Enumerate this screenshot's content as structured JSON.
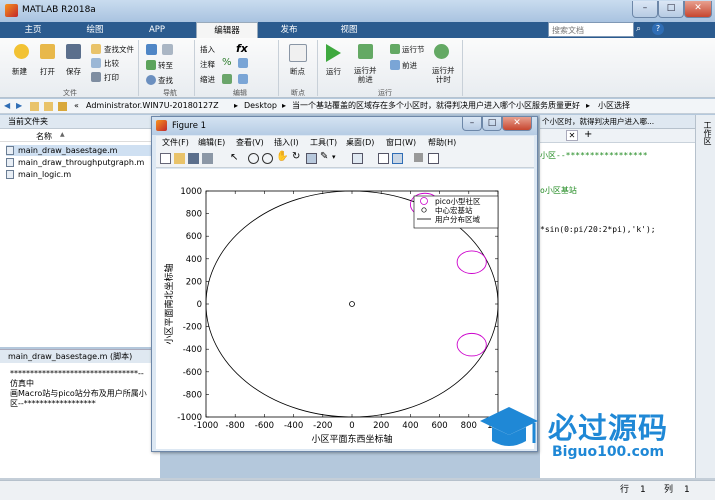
{
  "app": {
    "title": "MATLAB R2018a"
  },
  "window_controls": {
    "minimize": "–",
    "maximize": "□",
    "close": "✕"
  },
  "tabs": [
    {
      "label": "主页"
    },
    {
      "label": "绘图"
    },
    {
      "label": "APP"
    },
    {
      "label": "编辑器"
    },
    {
      "label": "发布"
    },
    {
      "label": "视图"
    }
  ],
  "search": {
    "placeholder": "搜索文档"
  },
  "ribbon": {
    "file": {
      "new": "新建",
      "open": "打开",
      "save": "保存",
      "find_files": "查找文件",
      "compare": "比较",
      "print": "打印",
      "group": "文件"
    },
    "navigate": {
      "goto": "转至",
      "find": "查找",
      "group": "导航"
    },
    "edit": {
      "insert": "插入",
      "comment": "注释",
      "indent": "缩进",
      "group": "编辑"
    },
    "breakpoints": {
      "label": "断点",
      "group": "断点"
    },
    "run": {
      "run": "运行",
      "run_advance": "运行并\n前进",
      "run_section": "运行节",
      "advance": "前进",
      "run_time": "运行并\n计时",
      "group": "运行"
    }
  },
  "pathbar": {
    "sep": "«",
    "crumbs": [
      "Administrator.WIN7U-20180127Z",
      "Desktop",
      "当一个基站覆盖的区域存在多个小区时，就得判决用户进入哪个小区服务质量更好",
      "小区选择"
    ]
  },
  "current_folder": {
    "title": "当前文件夹",
    "column": "名称",
    "sort": "▲",
    "files": [
      "main_draw_basestage.m",
      "main_draw_throughputgraph.m",
      "main_logic.m"
    ]
  },
  "details": {
    "title": "main_draw_basestage.m  (脚本)",
    "text": [
      "********************************--仿真中",
      "画Macro站与pico站分布及用户所属小",
      "区--******************"
    ]
  },
  "editor": {
    "tab_title": "个小区时，就得判决用户进入哪...",
    "lines": [
      "小区--*****************",
      "o小区基站",
      "*sin(0:pi/20:2*pi),'k');"
    ],
    "add_tab": "+"
  },
  "right_strip": {
    "label": "工作区"
  },
  "status": {
    "row_label": "行",
    "row": "1",
    "col_label": "列",
    "col": "1"
  },
  "figure": {
    "title": "Figure 1",
    "menu": [
      "文件(F)",
      "编辑(E)",
      "查看(V)",
      "插入(I)",
      "工具(T)",
      "桌面(D)",
      "窗口(W)",
      "帮助(H)"
    ]
  },
  "watermark": {
    "brand": "必过源码",
    "url": "Biguo100.com"
  },
  "chart_data": {
    "type": "scatter",
    "xlim": [
      -1000,
      1000
    ],
    "ylim": [
      -1000,
      1000
    ],
    "xticks": [
      -1000,
      -800,
      -600,
      -400,
      -200,
      0,
      200,
      400,
      600,
      800,
      1000
    ],
    "yticks": [
      -1000,
      -800,
      -600,
      -400,
      -200,
      0,
      200,
      400,
      600,
      800,
      1000
    ],
    "xlabel": "小区平面东西坐标轴",
    "ylabel": "小区平面南北坐标轴",
    "grid": false,
    "legend_position": "top-right",
    "legend": [
      "pico小型社区",
      "中心宏基站",
      "用户分布区域"
    ],
    "series": [
      {
        "name": "pico小型社区",
        "color": "#cc00cc",
        "marker": "circle",
        "radius": 100,
        "points": [
          [
            500,
            880
          ],
          [
            820,
            370
          ],
          [
            820,
            -360
          ]
        ]
      },
      {
        "name": "中心宏基站",
        "color": "#000000",
        "marker": "o",
        "points": [
          [
            0,
            0
          ]
        ]
      },
      {
        "name": "用户分布区域",
        "color": "#000000",
        "shape": "circle",
        "center": [
          0,
          0
        ],
        "radius": 1000
      }
    ]
  }
}
